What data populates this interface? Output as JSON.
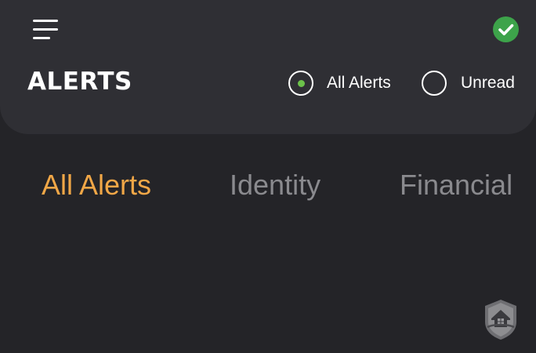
{
  "app": {
    "title": "ALERTS",
    "status_icon": "check-circle-icon",
    "menu_icon": "hamburger-menu-icon"
  },
  "filter": {
    "options": [
      {
        "label": "All Alerts",
        "selected": true
      },
      {
        "label": "Unread",
        "selected": false
      }
    ]
  },
  "tabs": [
    {
      "label": "All Alerts",
      "active": true
    },
    {
      "label": "Identity",
      "active": false
    },
    {
      "label": "Financial",
      "active": false
    }
  ],
  "watermark_icon": "shield-house-icon",
  "colors": {
    "background": "#242428",
    "header": "#2f2f34",
    "accent": "#f1a747",
    "tab_inactive": "#8a8a8e",
    "success": "#3da34a",
    "radio_dot": "#6cc24a",
    "text": "#ffffff"
  }
}
